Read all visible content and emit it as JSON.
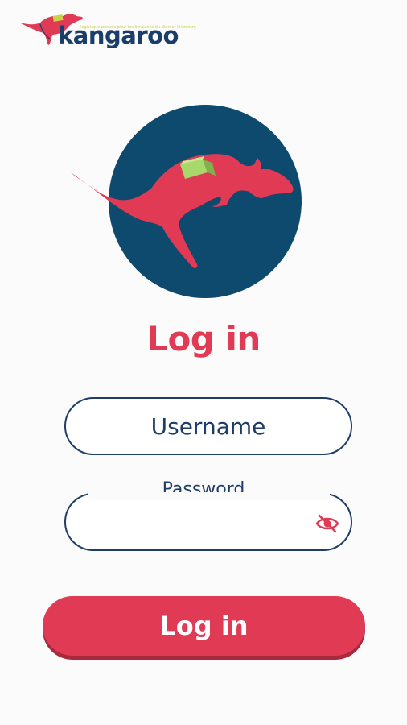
{
  "brand": {
    "name": "kangaroo",
    "tagline": "logistique pensée pour les livraisons du dernier kilomètre",
    "logo_icon": "kangaroo-logo-icon"
  },
  "emblem": {
    "icon": "kangaroo-with-package-icon",
    "circle_color": "#0e4a6e",
    "kangaroo_color": "#e03a54",
    "package_color": "#a6d86a"
  },
  "login": {
    "title": "Log in",
    "username_placeholder": "Username",
    "password_label": "Password",
    "password_value": "",
    "toggle_icon": "eye-slash-icon",
    "submit_label": "Log in"
  },
  "colors": {
    "accent": "#e03a54",
    "navy": "#1e3e66"
  }
}
